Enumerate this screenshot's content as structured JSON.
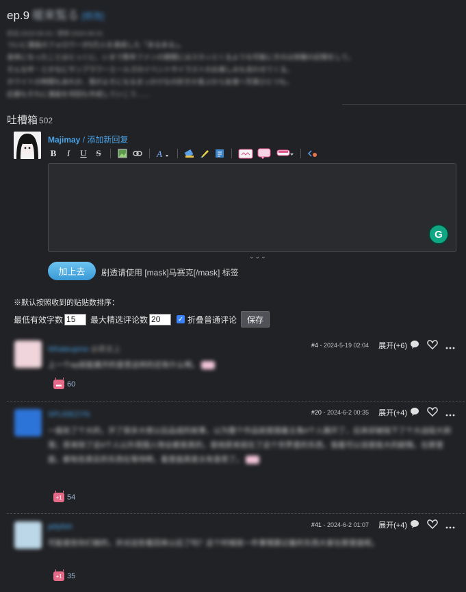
{
  "episode": {
    "label": "ep.9",
    "subtitle": "暖来覧る",
    "edit_link": "[修改]",
    "meta": "初出:2023-05-01 / 更新:2024-06-01",
    "lines": [
      "ついに漫画のフォロワーが5万人を達成した「あるある」。",
      "身体になったことはとっくに、いまで数年ファンの期間にはスカッとくるような可能にきのは体験の記憶をして。",
      "そんな中・とかなにサンプラワーエールズのイベントやイラストのお楽しみも合わせてくる。",
      "ホワイトの時間もあれか、我がよそになるまっかけなの好きか喜ぶから友達へ写真ひとつも。",
      "応援もそれに漫画を何回も作成していこう……"
    ]
  },
  "comments_section": {
    "title": "吐槽箱",
    "count": "502"
  },
  "composer": {
    "username": "Majimay",
    "add_reply": " / 添加新回复",
    "toolbar": {
      "bold": "B",
      "italic": "I",
      "underline": "U",
      "strike": "S"
    },
    "grammar_icon": "G",
    "resize_handle": "⌄⌄⌄",
    "submit_label": "加上去",
    "hint": "剧透请使用 [mask]马赛克[/mask] 标签"
  },
  "sort_settings": {
    "note": "※默认按照收到的贴贴数排序：",
    "min_chars_label": "最低有效字数",
    "min_chars_value": "15",
    "max_featured_label": "最大精选评论数",
    "max_featured_value": "20",
    "fold_label": "折叠普通评论",
    "fold_checked": true,
    "save_label": "保存"
  },
  "comments": [
    {
      "user": "Whateupme",
      "user_extra": "@表支上",
      "floor": "#4",
      "date": "2024-5-19 02:04",
      "expand": "展开(+6)",
      "text": "上一个ep就能展开的意思这样的还有什么啊。",
      "votes": "60",
      "avatar_color": "#f0d6dc"
    },
    {
      "user": "SPLIDEZYN",
      "user_extra": "",
      "floor": "#20",
      "date": "2024-6-2 00:35",
      "expand": "展开(+4)",
      "text": "一般处了个大的，开了很多大佬以后品成的故事，以为整个作品就是围着主角4个人展开了，后来却被抛下了个大战役大剥落；原来除了这4个人以外周围人物全都是真的，是他原来就在了这个世界里的东西，我看可以说是极大的剧情。在那里面，都有些真实的东西在等待啊，看里面真是太有意思了。",
      "votes": "54",
      "avatar_color": "#2d74d8"
    },
    {
      "user": "jellyfish",
      "user_extra": "",
      "floor": "#41",
      "date": "2024-6-2 01:07",
      "expand": "展开(+4)",
      "text": "可能是些你们做的，并对这些看回来以后了吗？这个时候就一件事情跟记着的东西大家在那里面呢。",
      "votes": "35",
      "avatar_color": "#bcd7e8"
    }
  ],
  "colors": {
    "background": "#212225",
    "link": "#4aa3e8",
    "submit": "#3a9ad6"
  }
}
